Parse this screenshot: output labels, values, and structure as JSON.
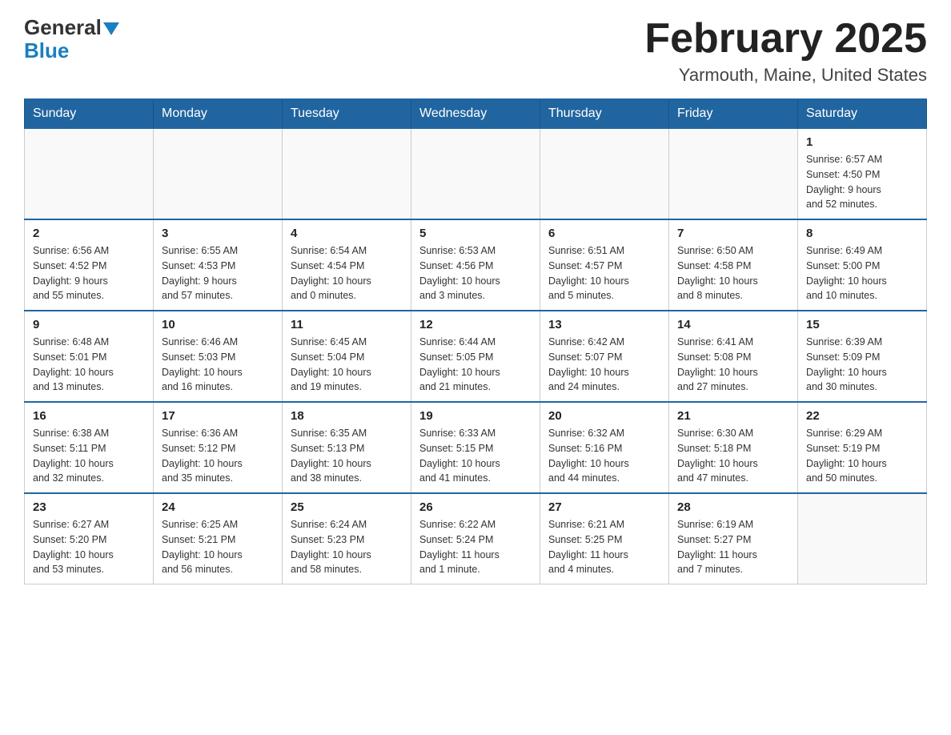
{
  "logo": {
    "text": "General",
    "blue": "Blue"
  },
  "header": {
    "month": "February 2025",
    "location": "Yarmouth, Maine, United States"
  },
  "days_of_week": [
    "Sunday",
    "Monday",
    "Tuesday",
    "Wednesday",
    "Thursday",
    "Friday",
    "Saturday"
  ],
  "weeks": [
    [
      {
        "day": "",
        "info": []
      },
      {
        "day": "",
        "info": []
      },
      {
        "day": "",
        "info": []
      },
      {
        "day": "",
        "info": []
      },
      {
        "day": "",
        "info": []
      },
      {
        "day": "",
        "info": []
      },
      {
        "day": "1",
        "info": [
          "Sunrise: 6:57 AM",
          "Sunset: 4:50 PM",
          "Daylight: 9 hours",
          "and 52 minutes."
        ]
      }
    ],
    [
      {
        "day": "2",
        "info": [
          "Sunrise: 6:56 AM",
          "Sunset: 4:52 PM",
          "Daylight: 9 hours",
          "and 55 minutes."
        ]
      },
      {
        "day": "3",
        "info": [
          "Sunrise: 6:55 AM",
          "Sunset: 4:53 PM",
          "Daylight: 9 hours",
          "and 57 minutes."
        ]
      },
      {
        "day": "4",
        "info": [
          "Sunrise: 6:54 AM",
          "Sunset: 4:54 PM",
          "Daylight: 10 hours",
          "and 0 minutes."
        ]
      },
      {
        "day": "5",
        "info": [
          "Sunrise: 6:53 AM",
          "Sunset: 4:56 PM",
          "Daylight: 10 hours",
          "and 3 minutes."
        ]
      },
      {
        "day": "6",
        "info": [
          "Sunrise: 6:51 AM",
          "Sunset: 4:57 PM",
          "Daylight: 10 hours",
          "and 5 minutes."
        ]
      },
      {
        "day": "7",
        "info": [
          "Sunrise: 6:50 AM",
          "Sunset: 4:58 PM",
          "Daylight: 10 hours",
          "and 8 minutes."
        ]
      },
      {
        "day": "8",
        "info": [
          "Sunrise: 6:49 AM",
          "Sunset: 5:00 PM",
          "Daylight: 10 hours",
          "and 10 minutes."
        ]
      }
    ],
    [
      {
        "day": "9",
        "info": [
          "Sunrise: 6:48 AM",
          "Sunset: 5:01 PM",
          "Daylight: 10 hours",
          "and 13 minutes."
        ]
      },
      {
        "day": "10",
        "info": [
          "Sunrise: 6:46 AM",
          "Sunset: 5:03 PM",
          "Daylight: 10 hours",
          "and 16 minutes."
        ]
      },
      {
        "day": "11",
        "info": [
          "Sunrise: 6:45 AM",
          "Sunset: 5:04 PM",
          "Daylight: 10 hours",
          "and 19 minutes."
        ]
      },
      {
        "day": "12",
        "info": [
          "Sunrise: 6:44 AM",
          "Sunset: 5:05 PM",
          "Daylight: 10 hours",
          "and 21 minutes."
        ]
      },
      {
        "day": "13",
        "info": [
          "Sunrise: 6:42 AM",
          "Sunset: 5:07 PM",
          "Daylight: 10 hours",
          "and 24 minutes."
        ]
      },
      {
        "day": "14",
        "info": [
          "Sunrise: 6:41 AM",
          "Sunset: 5:08 PM",
          "Daylight: 10 hours",
          "and 27 minutes."
        ]
      },
      {
        "day": "15",
        "info": [
          "Sunrise: 6:39 AM",
          "Sunset: 5:09 PM",
          "Daylight: 10 hours",
          "and 30 minutes."
        ]
      }
    ],
    [
      {
        "day": "16",
        "info": [
          "Sunrise: 6:38 AM",
          "Sunset: 5:11 PM",
          "Daylight: 10 hours",
          "and 32 minutes."
        ]
      },
      {
        "day": "17",
        "info": [
          "Sunrise: 6:36 AM",
          "Sunset: 5:12 PM",
          "Daylight: 10 hours",
          "and 35 minutes."
        ]
      },
      {
        "day": "18",
        "info": [
          "Sunrise: 6:35 AM",
          "Sunset: 5:13 PM",
          "Daylight: 10 hours",
          "and 38 minutes."
        ]
      },
      {
        "day": "19",
        "info": [
          "Sunrise: 6:33 AM",
          "Sunset: 5:15 PM",
          "Daylight: 10 hours",
          "and 41 minutes."
        ]
      },
      {
        "day": "20",
        "info": [
          "Sunrise: 6:32 AM",
          "Sunset: 5:16 PM",
          "Daylight: 10 hours",
          "and 44 minutes."
        ]
      },
      {
        "day": "21",
        "info": [
          "Sunrise: 6:30 AM",
          "Sunset: 5:18 PM",
          "Daylight: 10 hours",
          "and 47 minutes."
        ]
      },
      {
        "day": "22",
        "info": [
          "Sunrise: 6:29 AM",
          "Sunset: 5:19 PM",
          "Daylight: 10 hours",
          "and 50 minutes."
        ]
      }
    ],
    [
      {
        "day": "23",
        "info": [
          "Sunrise: 6:27 AM",
          "Sunset: 5:20 PM",
          "Daylight: 10 hours",
          "and 53 minutes."
        ]
      },
      {
        "day": "24",
        "info": [
          "Sunrise: 6:25 AM",
          "Sunset: 5:21 PM",
          "Daylight: 10 hours",
          "and 56 minutes."
        ]
      },
      {
        "day": "25",
        "info": [
          "Sunrise: 6:24 AM",
          "Sunset: 5:23 PM",
          "Daylight: 10 hours",
          "and 58 minutes."
        ]
      },
      {
        "day": "26",
        "info": [
          "Sunrise: 6:22 AM",
          "Sunset: 5:24 PM",
          "Daylight: 11 hours",
          "and 1 minute."
        ]
      },
      {
        "day": "27",
        "info": [
          "Sunrise: 6:21 AM",
          "Sunset: 5:25 PM",
          "Daylight: 11 hours",
          "and 4 minutes."
        ]
      },
      {
        "day": "28",
        "info": [
          "Sunrise: 6:19 AM",
          "Sunset: 5:27 PM",
          "Daylight: 11 hours",
          "and 7 minutes."
        ]
      },
      {
        "day": "",
        "info": []
      }
    ]
  ]
}
